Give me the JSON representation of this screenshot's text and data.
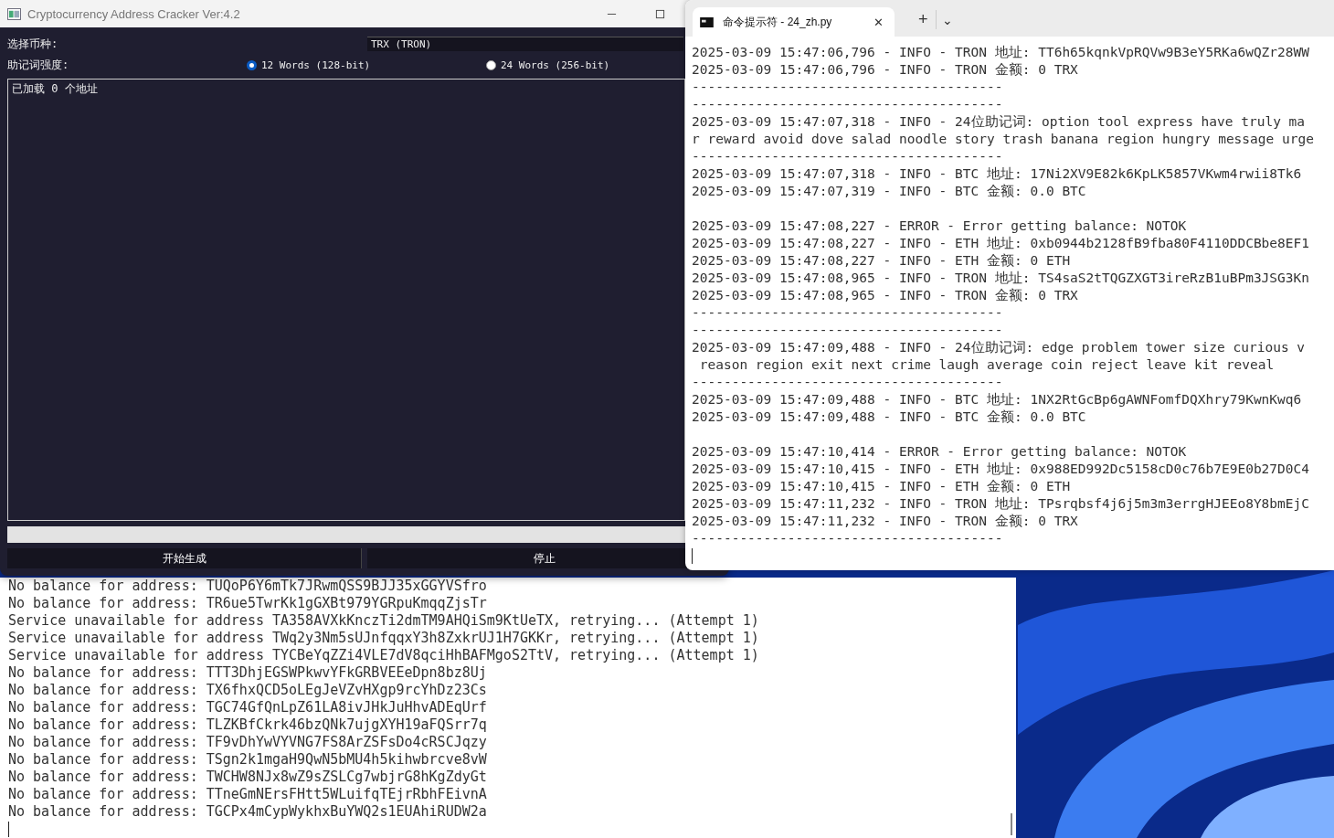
{
  "app_window": {
    "title": "Cryptocurrency Address Cracker Ver:4.2",
    "coin": {
      "label": "选择币种:",
      "value": "TRX (TRON)"
    },
    "strength": {
      "label": "助记词强度:",
      "options": [
        {
          "label": "12 Words (128-bit)",
          "selected": true
        },
        {
          "label": "24 Words (256-bit)",
          "selected": false
        }
      ]
    },
    "log_text": "已加载 0 个地址",
    "progress": {
      "level": 0
    },
    "buttons": [
      "开始生成",
      "停止"
    ]
  },
  "terminal": {
    "tab_title": "命令提示符 - 24_zh.py",
    "tab_close": "✕",
    "new_tab": "+",
    "dropdown": "⌄",
    "lines": [
      {
        "kind": "text",
        "text": "2025-03-09 15:47:06,796 - INFO - TRON 地址: TT6h65kqnkVpRQVw9B3eY5RKa6wQZr28WW"
      },
      {
        "kind": "text",
        "text": "2025-03-09 15:47:06,796 - INFO - TRON 金额: 0 TRX"
      },
      {
        "kind": "text",
        "text": "---------------------------------------"
      },
      {
        "kind": "text",
        "text": "---------------------------------------"
      },
      {
        "kind": "text",
        "text": "2025-03-09 15:47:07,318 - INFO - 24位助记词: option tool express have truly ma"
      },
      {
        "kind": "text",
        "text": "r reward avoid dove salad noodle story trash banana region hungry message urge"
      },
      {
        "kind": "text",
        "text": "---------------------------------------"
      },
      {
        "kind": "text",
        "text": "2025-03-09 15:47:07,318 - INFO - BTC 地址: 17Ni2XV9E82k6KpLK5857VKwm4rwii8Tk6"
      },
      {
        "kind": "text",
        "text": "2025-03-09 15:47:07,319 - INFO - BTC 金额: 0.0 BTC"
      },
      {
        "kind": "gap"
      },
      {
        "kind": "text",
        "text": "2025-03-09 15:47:08,227 - ERROR - Error getting balance: NOTOK"
      },
      {
        "kind": "text",
        "text": "2025-03-09 15:47:08,227 - INFO - ETH 地址: 0xb0944b2128fB9fba80F4110DDCBbe8EF1"
      },
      {
        "kind": "text",
        "text": "2025-03-09 15:47:08,227 - INFO - ETH 金额: 0 ETH"
      },
      {
        "kind": "text",
        "text": "2025-03-09 15:47:08,965 - INFO - TRON 地址: TS4saS2tTQGZXGT3ireRzB1uBPm3JSG3Kn"
      },
      {
        "kind": "text",
        "text": "2025-03-09 15:47:08,965 - INFO - TRON 金额: 0 TRX"
      },
      {
        "kind": "text",
        "text": "---------------------------------------"
      },
      {
        "kind": "text",
        "text": "---------------------------------------"
      },
      {
        "kind": "text",
        "text": "2025-03-09 15:47:09,488 - INFO - 24位助记词: edge problem tower size curious v"
      },
      {
        "kind": "text",
        "text": " reason region exit next crime laugh average coin reject leave kit reveal"
      },
      {
        "kind": "text",
        "text": "---------------------------------------"
      },
      {
        "kind": "text",
        "text": "2025-03-09 15:47:09,488 - INFO - BTC 地址: 1NX2RtGcBp6gAWNFomfDQXhry79KwnKwq6"
      },
      {
        "kind": "text",
        "text": "2025-03-09 15:47:09,488 - INFO - BTC 金额: 0.0 BTC"
      },
      {
        "kind": "gap"
      },
      {
        "kind": "text",
        "text": "2025-03-09 15:47:10,414 - ERROR - Error getting balance: NOTOK"
      },
      {
        "kind": "text",
        "text": "2025-03-09 15:47:10,415 - INFO - ETH 地址: 0x988ED992Dc5158cD0c76b7E9E0b27D0C4"
      },
      {
        "kind": "text",
        "text": "2025-03-09 15:47:10,415 - INFO - ETH 金额: 0 ETH"
      },
      {
        "kind": "text",
        "text": "2025-03-09 15:47:11,232 - INFO - TRON 地址: TPsrqbsf4j6j5m3m3errgHJEEo8Y8bmEjC"
      },
      {
        "kind": "text",
        "text": "2025-03-09 15:47:11,232 - INFO - TRON 金额: 0 TRX"
      },
      {
        "kind": "text",
        "text": "---------------------------------------"
      }
    ]
  },
  "console": {
    "lines": [
      "No balance for address: TUQoP6Y6mTk7JRwmQSS9BJJ35xGGYVSfro",
      "No balance for address: TR6ue5TwrKk1gGXBt979YGRpuKmqqZjsTr",
      "Service unavailable for address TA358AVXkKnczTi2dmTM9AHQiSm9KtUeTX, retrying... (Attempt 1)",
      "Service unavailable for address TWq2y3Nm5sUJnfqqxY3h8ZxkrUJ1H7GKKr, retrying... (Attempt 1)",
      "Service unavailable for address TYCBeYqZZi4VLE7dV8qciHhBAFMgoS2TtV, retrying... (Attempt 1)",
      "No balance for address: TTT3DhjEGSWPkwvYFkGRBVEEeDpn8bz8Uj",
      "No balance for address: TX6fhxQCD5oLEgJeVZvHXgp9rcYhDz23Cs",
      "No balance for address: TGC74GfQnLpZ61LA8ivJHkJuHhvADEqUrf",
      "No balance for address: TLZKBfCkrk46bzQNk7ujgXYH19aFQSrr7q",
      "No balance for address: TF9vDhYwVYVNG7FS8ArZSFsDo4cRSCJqzy",
      "No balance for address: TSgn2k1mgaH9QwN5bMU4h5kihwbrcve8vW",
      "No balance for address: TWCHW8NJx8wZ9sZSLCg7wbjrG8hKgZdyGt",
      "No balance for address: TTneGmNErsFHtt5WLuifqTEjrRbhFEivnA",
      "No balance for address: TGCPx4mCypWykhxBuYWQ2s1EUAhiRUDW2a"
    ]
  }
}
